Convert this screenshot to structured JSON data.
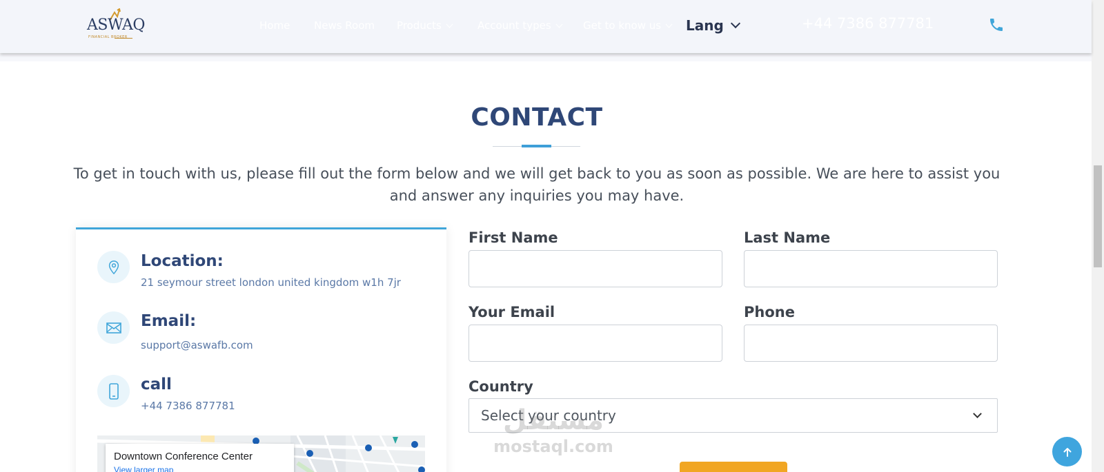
{
  "header": {
    "logo": {
      "text": "ASWAQ",
      "subtext": "FINANCIAL BROKER"
    },
    "nav": [
      {
        "label": "Home"
      },
      {
        "label": "News Room"
      },
      {
        "label": "Products"
      },
      {
        "label": "Account types"
      },
      {
        "label": "Get to know us"
      }
    ],
    "lang_label": "Lang",
    "phone_number": "+44 7386 877781",
    "phone_icon": "phone-icon"
  },
  "section": {
    "title": "CONTACT",
    "intro": "To get in touch with us, please fill out the form below and we will get back to you as soon as possible. We are here to assist you and answer any inquiries you may have."
  },
  "info": {
    "location": {
      "title": "Location:",
      "value": "21 seymour street london united kingdom w1h 7jr",
      "icon": "map-pin-icon"
    },
    "email": {
      "title": "Email:",
      "value": "support@aswafb.com",
      "icon": "envelope-icon"
    },
    "call": {
      "title": "call",
      "value": "+44 7386 877781",
      "icon": "mobile-phone-icon"
    }
  },
  "map": {
    "place_title": "Downtown Conference Center",
    "link_text": "View larger map"
  },
  "form": {
    "first_name_label": "First Name",
    "last_name_label": "Last Name",
    "email_label": "Your Email",
    "phone_label": "Phone",
    "country_label": "Country",
    "country_placeholder": "Select your country"
  },
  "watermark": {
    "arabic": "مستقل",
    "latin": "mostaql.com"
  },
  "colors": {
    "primary_navy": "#2f4777",
    "accent_blue": "#3fa5d9",
    "button_orange": "#f1a623",
    "header_bg": "#f3f5fa"
  }
}
